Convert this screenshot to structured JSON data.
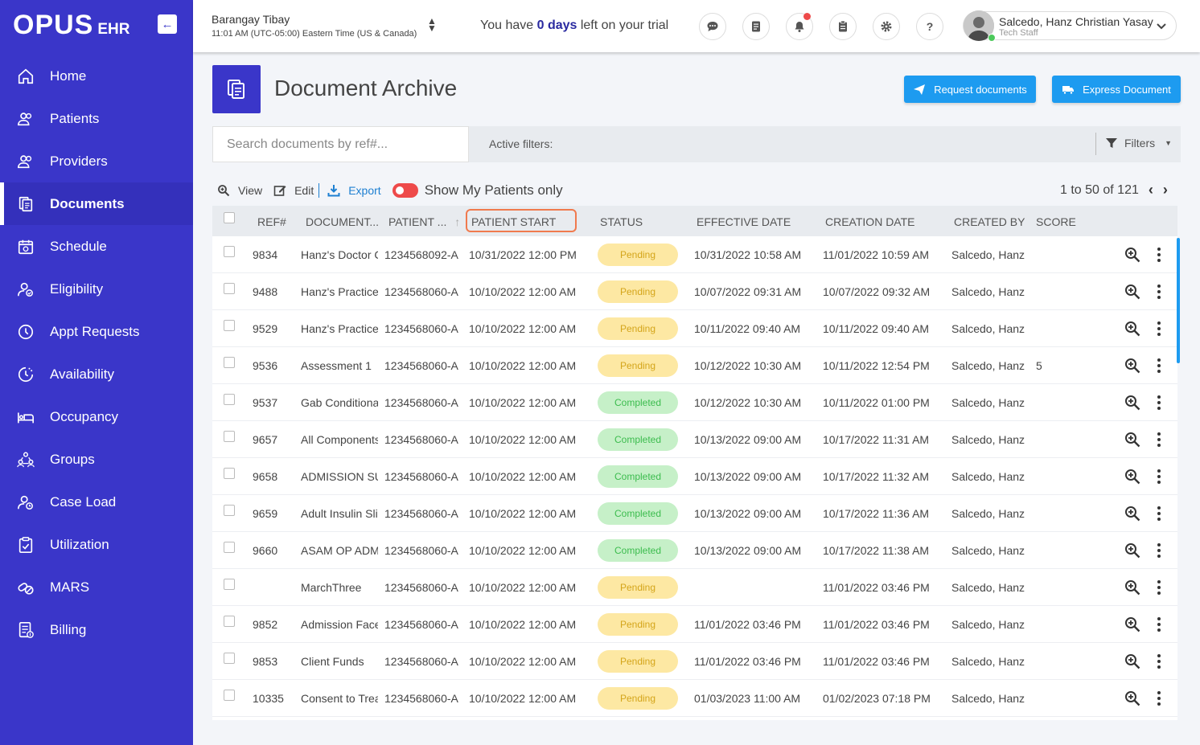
{
  "app": {
    "logo_main": "OPUS",
    "logo_sub": "EHR"
  },
  "sidebar": {
    "items": [
      {
        "label": "Home",
        "icon": "home-icon"
      },
      {
        "label": "Patients",
        "icon": "patients-icon"
      },
      {
        "label": "Providers",
        "icon": "providers-icon"
      },
      {
        "label": "Documents",
        "icon": "documents-icon",
        "active": true
      },
      {
        "label": "Schedule",
        "icon": "schedule-icon"
      },
      {
        "label": "Eligibility",
        "icon": "eligibility-icon"
      },
      {
        "label": "Appt Requests",
        "icon": "clock-icon"
      },
      {
        "label": "Availability",
        "icon": "availability-icon"
      },
      {
        "label": "Occupancy",
        "icon": "bed-icon"
      },
      {
        "label": "Groups",
        "icon": "groups-icon"
      },
      {
        "label": "Case Load",
        "icon": "caseload-icon"
      },
      {
        "label": "Utilization",
        "icon": "clipboard-check-icon"
      },
      {
        "label": "MARS",
        "icon": "pills-icon"
      },
      {
        "label": "Billing",
        "icon": "billing-icon"
      }
    ]
  },
  "topbar": {
    "location_name": "Barangay Tibay",
    "location_time": "11:01 AM (UTC-05:00) Eastern Time (US & Canada)",
    "trial_prefix": "You have ",
    "trial_days": "0 days",
    "trial_suffix": " left on your trial",
    "user_name": "Salcedo, Hanz Christian Yasay",
    "user_role": "Tech Staff"
  },
  "header": {
    "title": "Document Archive",
    "request_btn": "Request documents",
    "express_btn": "Express Document"
  },
  "filters": {
    "search_placeholder": "Search documents by ref#...",
    "active_label": "Active filters:",
    "filters_btn": "Filters"
  },
  "toolbar": {
    "view": "View",
    "edit": "Edit",
    "export": "Export",
    "show_mine": "Show My Patients only",
    "pagination": "1 to 50 of 121"
  },
  "table": {
    "columns": [
      "REF#",
      "DOCUMENT...",
      "PATIENT ...",
      "PATIENT START",
      "STATUS",
      "EFFECTIVE DATE",
      "CREATION DATE",
      "CREATED BY",
      "SCORE"
    ],
    "rows": [
      {
        "ref": "9834",
        "doc": "Hanz's Doctor C",
        "patient": "1234568092-A",
        "start": "10/31/2022 12:00 PM",
        "status": "Pending",
        "effective": "10/31/2022 10:58 AM",
        "created": "11/01/2022 10:59 AM",
        "by": "Salcedo, Hanz C",
        "score": ""
      },
      {
        "ref": "9488",
        "doc": "Hanz's Practice",
        "patient": "1234568060-A",
        "start": "10/10/2022 12:00 AM",
        "status": "Pending",
        "effective": "10/07/2022 09:31 AM",
        "created": "10/07/2022 09:32 AM",
        "by": "Salcedo, Hanz C",
        "score": ""
      },
      {
        "ref": "9529",
        "doc": "Hanz's Practice",
        "patient": "1234568060-A",
        "start": "10/10/2022 12:00 AM",
        "status": "Pending",
        "effective": "10/11/2022 09:40 AM",
        "created": "10/11/2022 09:40 AM",
        "by": "Salcedo, Hanz C",
        "score": ""
      },
      {
        "ref": "9536",
        "doc": "Assessment 1",
        "patient": "1234568060-A",
        "start": "10/10/2022 12:00 AM",
        "status": "Pending",
        "effective": "10/12/2022 10:30 AM",
        "created": "10/11/2022 12:54 PM",
        "by": "Salcedo, Hanz C",
        "score": "5"
      },
      {
        "ref": "9537",
        "doc": "Gab Conditiona",
        "patient": "1234568060-A",
        "start": "10/10/2022 12:00 AM",
        "status": "Completed",
        "effective": "10/12/2022 10:30 AM",
        "created": "10/11/2022 01:00 PM",
        "by": "Salcedo, Hanz C",
        "score": ""
      },
      {
        "ref": "9657",
        "doc": "All Components",
        "patient": "1234568060-A",
        "start": "10/10/2022 12:00 AM",
        "status": "Completed",
        "effective": "10/13/2022 09:00 AM",
        "created": "10/17/2022 11:31 AM",
        "by": "Salcedo, Hanz C",
        "score": ""
      },
      {
        "ref": "9658",
        "doc": "ADMISSION SU",
        "patient": "1234568060-A",
        "start": "10/10/2022 12:00 AM",
        "status": "Completed",
        "effective": "10/13/2022 09:00 AM",
        "created": "10/17/2022 11:32 AM",
        "by": "Salcedo, Hanz C",
        "score": ""
      },
      {
        "ref": "9659",
        "doc": "Adult Insulin Sli",
        "patient": "1234568060-A",
        "start": "10/10/2022 12:00 AM",
        "status": "Completed",
        "effective": "10/13/2022 09:00 AM",
        "created": "10/17/2022 11:36 AM",
        "by": "Salcedo, Hanz C",
        "score": ""
      },
      {
        "ref": "9660",
        "doc": "ASAM OP ADMI",
        "patient": "1234568060-A",
        "start": "10/10/2022 12:00 AM",
        "status": "Completed",
        "effective": "10/13/2022 09:00 AM",
        "created": "10/17/2022 11:38 AM",
        "by": "Salcedo, Hanz C",
        "score": ""
      },
      {
        "ref": "",
        "doc": "MarchThree",
        "patient": "1234568060-A",
        "start": "10/10/2022 12:00 AM",
        "status": "Pending",
        "effective": "",
        "created": "11/01/2022 03:46 PM",
        "by": "Salcedo, Hanz C",
        "score": ""
      },
      {
        "ref": "9852",
        "doc": "Admission Face",
        "patient": "1234568060-A",
        "start": "10/10/2022 12:00 AM",
        "status": "Pending",
        "effective": "11/01/2022 03:46 PM",
        "created": "11/01/2022 03:46 PM",
        "by": "Salcedo, Hanz C",
        "score": ""
      },
      {
        "ref": "9853",
        "doc": "Client Funds",
        "patient": "1234568060-A",
        "start": "10/10/2022 12:00 AM",
        "status": "Pending",
        "effective": "11/01/2022 03:46 PM",
        "created": "11/01/2022 03:46 PM",
        "by": "Salcedo, Hanz C",
        "score": ""
      },
      {
        "ref": "10335",
        "doc": "Consent to Trea",
        "patient": "1234568060-A",
        "start": "10/10/2022 12:00 AM",
        "status": "Pending",
        "effective": "01/03/2023 11:00 AM",
        "created": "01/02/2023 07:18 PM",
        "by": "Salcedo, Hanz C",
        "score": ""
      }
    ]
  },
  "colors": {
    "brand": "#3a36c9",
    "accent": "#1d9bf0",
    "pending": "#fde8a3",
    "completed": "#c6f0c8",
    "highlight": "#f07a4e"
  }
}
